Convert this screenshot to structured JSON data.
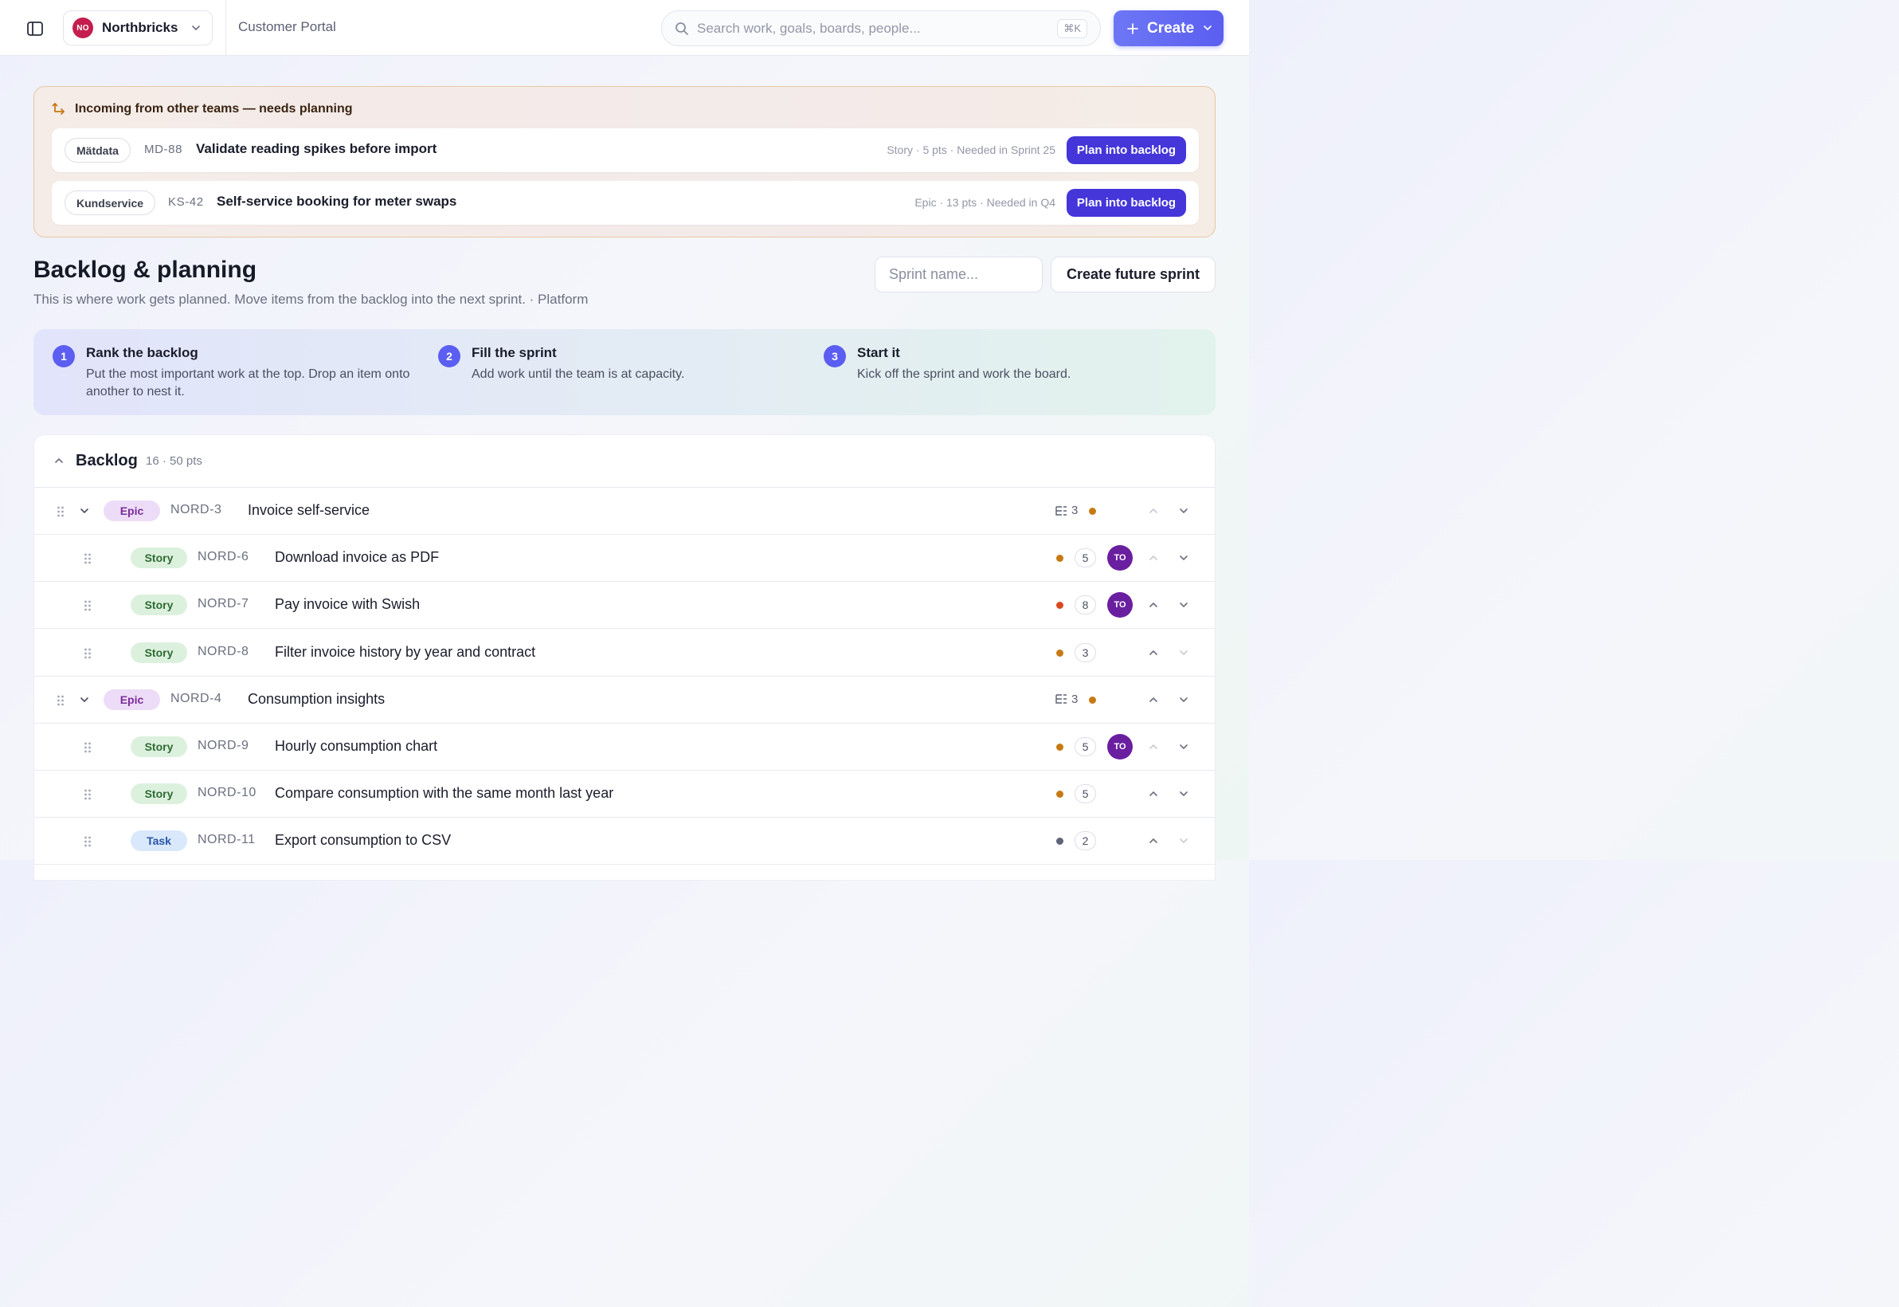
{
  "topbar": {
    "workspace_initials": "NO",
    "workspace_name": "Northbricks",
    "project_name": "Customer Portal",
    "search_placeholder": "Search work, goals, boards, people...",
    "search_shortcut": "⌘K",
    "create_label": "Create"
  },
  "incoming": {
    "title": "Incoming from other teams — needs planning",
    "items": [
      {
        "team": "Mätdata",
        "key": "MD-88",
        "title": "Validate reading spikes before import",
        "meta": "Story · 5 pts · Needed in Sprint 25",
        "action": "Plan into backlog"
      },
      {
        "team": "Kundservice",
        "key": "KS-42",
        "title": "Self-service booking for meter swaps",
        "meta": "Epic · 13 pts · Needed in Q4",
        "action": "Plan into backlog"
      }
    ]
  },
  "page": {
    "title": "Backlog & planning",
    "subtitle": "This is where work gets planned. Move items from the backlog into the next sprint. · Platform",
    "sprint_placeholder": "Sprint name...",
    "future_sprint_label": "Create future sprint"
  },
  "steps": [
    {
      "num": "1",
      "title": "Rank the backlog",
      "desc": "Put the most important work at the top. Drop an item onto another to nest it."
    },
    {
      "num": "2",
      "title": "Fill the sprint",
      "desc": "Add work until the team is at capacity."
    },
    {
      "num": "3",
      "title": "Start it",
      "desc": "Kick off the sprint and work the board."
    }
  ],
  "backlog": {
    "title": "Backlog",
    "count": "16 · 50 pts",
    "rows": [
      {
        "level": 0,
        "type": "Epic",
        "key": "NORD-3",
        "title": "Invoice self-service",
        "children": "3",
        "priority": "#c77a12"
      },
      {
        "level": 1,
        "type": "Story",
        "key": "NORD-6",
        "title": "Download invoice as PDF",
        "points": "5",
        "assignee": "TO",
        "priority": "#c77a12"
      },
      {
        "level": 1,
        "type": "Story",
        "key": "NORD-7",
        "title": "Pay invoice with Swish",
        "points": "8",
        "assignee": "TO",
        "priority": "#d9481e"
      },
      {
        "level": 1,
        "type": "Story",
        "key": "NORD-8",
        "title": "Filter invoice history by year and contract",
        "points": "3",
        "priority": "#c77a12"
      },
      {
        "level": 0,
        "type": "Epic",
        "key": "NORD-4",
        "title": "Consumption insights",
        "children": "3",
        "priority": "#c77a12"
      },
      {
        "level": 1,
        "type": "Story",
        "key": "NORD-9",
        "title": "Hourly consumption chart",
        "points": "5",
        "assignee": "TO",
        "priority": "#c77a12"
      },
      {
        "level": 1,
        "type": "Story",
        "key": "NORD-10",
        "title": "Compare consumption with the same month last year",
        "points": "5",
        "priority": "#c77a12"
      },
      {
        "level": 1,
        "type": "Task",
        "key": "NORD-11",
        "title": "Export consumption to CSV",
        "points": "2",
        "priority": "#5f6578"
      }
    ]
  }
}
